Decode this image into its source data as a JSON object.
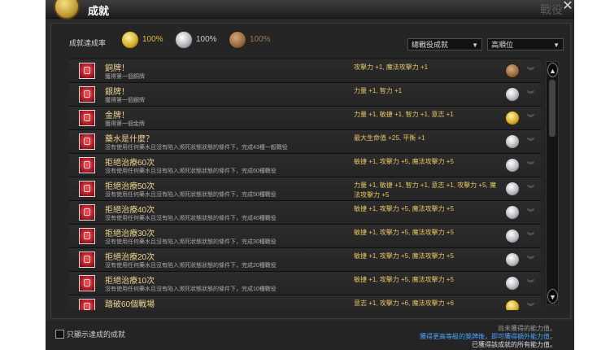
{
  "window": {
    "title": "成就",
    "background_title": "戰役"
  },
  "header": {
    "rate_label": "成就達成率",
    "medals": [
      {
        "tier": "gold",
        "percent": "100%"
      },
      {
        "tier": "silver",
        "percent": "100%"
      },
      {
        "tier": "bronze",
        "percent": "100%"
      }
    ],
    "filter_category": "總戰役成就",
    "filter_sort": "高順位"
  },
  "achievements": [
    {
      "title": "銅牌！",
      "desc": "獲得第一個銅牌",
      "reward": "攻擊力 +1, 魔法攻擊力 +1",
      "medal": "bronze"
    },
    {
      "title": "銀牌！",
      "desc": "獲得第一個銀牌",
      "reward": "力量 +1, 智力 +1",
      "medal": "silver"
    },
    {
      "title": "金牌！",
      "desc": "獲得第一個金牌",
      "reward": "力量 +1, 敏捷 +1, 智力 +1, 意志 +1",
      "medal": "gold"
    },
    {
      "title": "藥水是什麼？",
      "desc": "沒有使用任何藥水且沒有陷入瀕死狀態狀態的條件下，完成43種一般戰役",
      "reward": "最大生命值 +25, 平衡 +1",
      "medal": "silver"
    },
    {
      "title": "拒絕治療60次",
      "desc": "沒有使用任何藥水且沒有陷入瀕死狀態狀態的條件下，完成60種戰役",
      "reward": "敏捷 +1, 攻擊力 +5, 魔法攻擊力 +5",
      "medal": "silver"
    },
    {
      "title": "拒絕治療50次",
      "desc": "沒有使用任何藥水且沒有陷入瀕死狀態狀態的條件下，完成50種戰役",
      "reward": "力量 +1, 敏捷 +1, 智力 +1, 意志 +1, 攻擊力 +5, 魔法攻擊力 +5",
      "medal": "silver"
    },
    {
      "title": "拒絕治療40次",
      "desc": "沒有使用任何藥水且沒有陷入瀕死狀態狀態的條件下，完成40種戰役",
      "reward": "敏捷 +1, 攻擊力 +5, 魔法攻擊力 +5",
      "medal": "silver"
    },
    {
      "title": "拒絕治療30次",
      "desc": "沒有使用任何藥水且沒有陷入瀕死狀態狀態的條件下，完成30種戰役",
      "reward": "敏捷 +1, 攻擊力 +5, 魔法攻擊力 +5",
      "medal": "silver"
    },
    {
      "title": "拒絕治療20次",
      "desc": "沒有使用任何藥水且沒有陷入瀕死狀態狀態的條件下，完成20種戰役",
      "reward": "敏捷 +1, 攻擊力 +5, 魔法攻擊力 +5",
      "medal": "silver"
    },
    {
      "title": "拒絕治療10次",
      "desc": "沒有使用任何藥水且沒有陷入瀕死狀態狀態的條件下，完成10種戰役",
      "reward": "敏捷 +1, 攻擊力 +5, 魔法攻擊力 +5",
      "medal": "silver"
    },
    {
      "title": "踏破60個戰場",
      "desc": "",
      "reward": "意志 +1, 攻擊力 +6, 魔法攻擊力 +6",
      "medal": "gold"
    }
  ],
  "footer": {
    "show_completed_label": "只顯示達成的成就",
    "legend_unobtained": "尚未獲得的能力值。",
    "legend_next_tier": "獲得更高等級的獎牌後，即可獲得額外能力值。",
    "legend_obtained": "已獲得該成就的所有能力值。"
  },
  "icons": {
    "close": "close-icon",
    "expand": "chevron-double-down-icon",
    "scroll_up": "chevron-up-icon",
    "scroll_down": "chevron-down-icon"
  }
}
